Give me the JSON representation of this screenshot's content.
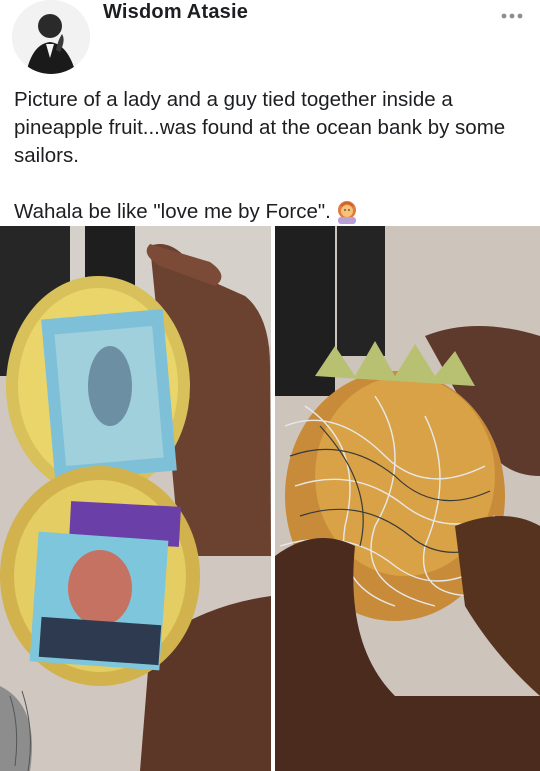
{
  "post": {
    "author_name": "Wisdom Atasie",
    "more_icon": "more-horizontal-icon",
    "text_line1": "Picture of a lady and a guy tied together inside a pineapple fruit...was found at the ocean bank by some sailors.",
    "text_line2": "Wahala be like \"love me by Force\".",
    "emoji": "woman-gesturing-emoji"
  },
  "photos": [
    {
      "description": "opened-pineapple-with-photos"
    },
    {
      "description": "pineapple-wrapped-in-wires"
    }
  ]
}
